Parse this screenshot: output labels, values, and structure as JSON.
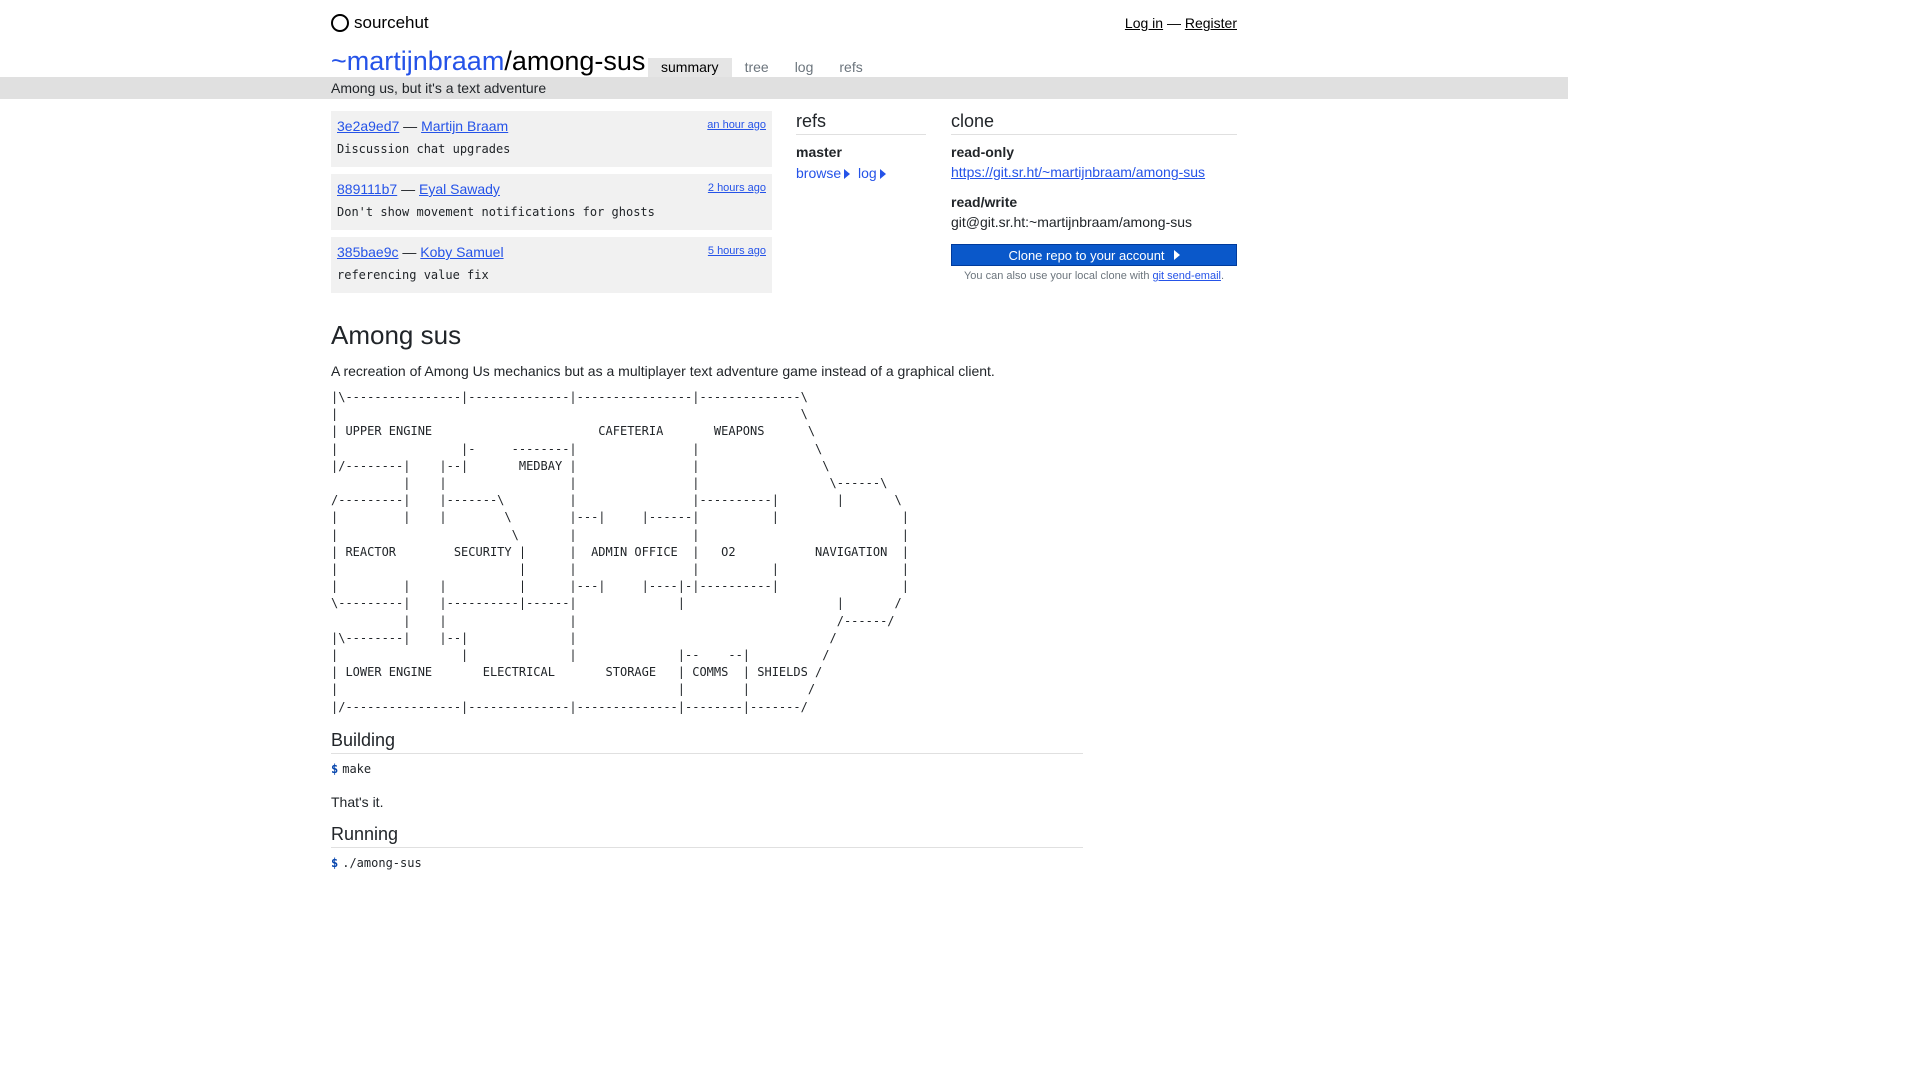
{
  "brand": {
    "name": "sourcehut",
    "icon": "ring-logo-icon"
  },
  "auth": {
    "login": "Log in",
    "sep": " — ",
    "register": "Register"
  },
  "repo": {
    "owner": "~martijnbraam",
    "slash": "/",
    "name": "among-sus",
    "description": "Among us, but it's a text adventure"
  },
  "tabs": [
    {
      "label": "summary",
      "active": true
    },
    {
      "label": "tree"
    },
    {
      "label": "log"
    },
    {
      "label": "refs"
    }
  ],
  "commits": [
    {
      "hash": "3e2a9ed7",
      "sep": " — ",
      "author": "Martijn Braam",
      "when": "an hour ago",
      "message": "Discussion chat upgrades"
    },
    {
      "hash": "889111b7",
      "sep": " — ",
      "author": "Eyal Sawady",
      "when": "2 hours ago",
      "message": "Don't show movement notifications for ghosts"
    },
    {
      "hash": "385bae9c",
      "sep": " — ",
      "author": "Koby Samuel",
      "when": "5 hours ago",
      "message": "referencing value fix"
    }
  ],
  "refs": {
    "heading": "refs",
    "branch": "master",
    "browse": "browse",
    "log": "log"
  },
  "clone": {
    "heading": "clone",
    "readonly_label": "read-only",
    "readonly_url": "https://git.sr.ht/~martijnbraam/among-sus",
    "readwrite_label": "read/write",
    "readwrite_url": "git@git.sr.ht:~martijnbraam/among-sus",
    "button": "Clone repo to your account",
    "hint_prefix": "You can also use your local clone with ",
    "hint_link": "git send-email",
    "hint_suffix": "."
  },
  "readme": {
    "title": "Among sus",
    "intro": "A recreation of Among Us mechanics but as a multiplayer text adventure game instead of a graphical client.",
    "map": "|\\----------------|--------------|----------------|--------------\\\n|                                                                \\\n| UPPER ENGINE                       CAFETERIA       WEAPONS      \\\n|                 |-     --------|                |                \\\n|/--------|    |--|       MEDBAY |                |                 \\\n          |    |                 |                |                  \\------\\\n/---------|    |-------\\         |                |----------|        |       \\\n|         |    |        \\        |---|     |------|          |                 |\n|                        \\       |                |                            |\n| REACTOR        SECURITY |      |  ADMIN OFFICE  |   O2           NAVIGATION  |\n|                         |      |                |          |                 |\n|         |    |          |      |---|     |----|-|----------|                 |\n\\---------|    |----------|------|              |                     |       /\n          |    |                 |                                    /------/\n|\\--------|    |--|              |                                   /\n|                 |              |              |--    --|          /\n| LOWER ENGINE       ELECTRICAL       STORAGE   | COMMS  | SHIELDS /\n|                                               |        |        /\n|/----------------|--------------|--------------|--------|-------/",
    "building_heading": "Building",
    "build_prompt": "$",
    "build_cmd": "make",
    "thats_it": "That's it.",
    "running_heading": "Running",
    "run_prompt": "$",
    "run_cmd": "./among-sus"
  },
  "colors": {
    "link": "#2553e8",
    "button": "#0a58ca",
    "subbar": "#e0e0e0"
  }
}
